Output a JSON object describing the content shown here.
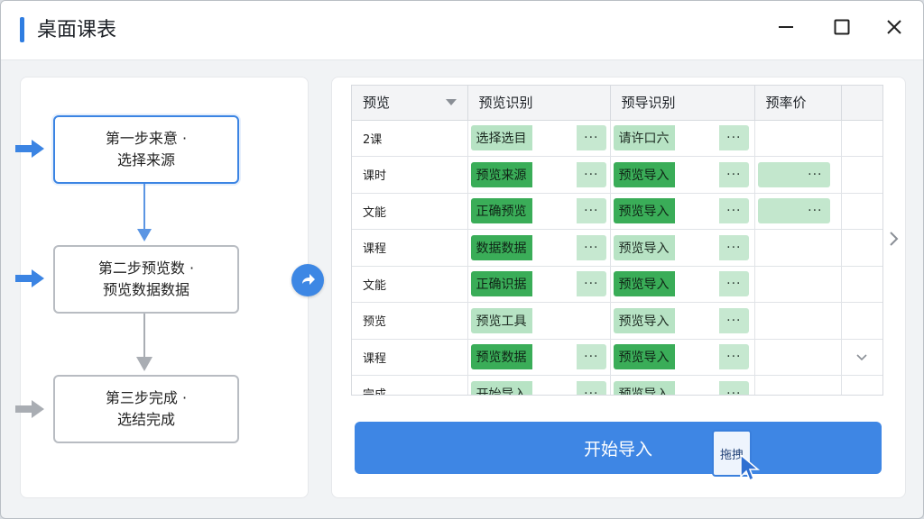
{
  "window": {
    "title": "桌面课表"
  },
  "steps": [
    {
      "line1": "第一步来意 ·",
      "line2": "选择来源"
    },
    {
      "line1": "第二步预览数 ·",
      "line2": "预览数据数据"
    },
    {
      "line1": "第三步完成 ·",
      "line2": "选结完成"
    }
  ],
  "table": {
    "headers": [
      "预览",
      "预览识别",
      "预导识别",
      "预率价"
    ],
    "rows": [
      {
        "label": "2课",
        "c1": "选择选目",
        "c2": "请许口六",
        "c3": ""
      },
      {
        "label": "课时",
        "c1": "预览来源",
        "c2": "预览导入",
        "c3": ""
      },
      {
        "label": "文能",
        "c1": "正确预览",
        "c2": "预览导入",
        "c3": ""
      },
      {
        "label": "课程",
        "c1": "数据数据",
        "c2": "预览导入",
        "c3": ""
      },
      {
        "label": "文能",
        "c1": "正确识据",
        "c2": "预览导入",
        "c3": ""
      },
      {
        "label": "预览",
        "c1": "预览工具",
        "c2": "预览导入",
        "c3": ""
      },
      {
        "label": "课程",
        "c1": "预览数据",
        "c2": "预览导入",
        "c3": ""
      },
      {
        "label": "完成",
        "c1": "开始导入",
        "c2": "预览导入",
        "c3": ""
      }
    ],
    "dots": "···"
  },
  "actions": {
    "import_label": "开始导入",
    "drag_label": "拖拽"
  },
  "colors": {
    "accent": "#3e86e4",
    "chip_dark": "#3aad58",
    "chip_light": "#b7e3c4"
  }
}
